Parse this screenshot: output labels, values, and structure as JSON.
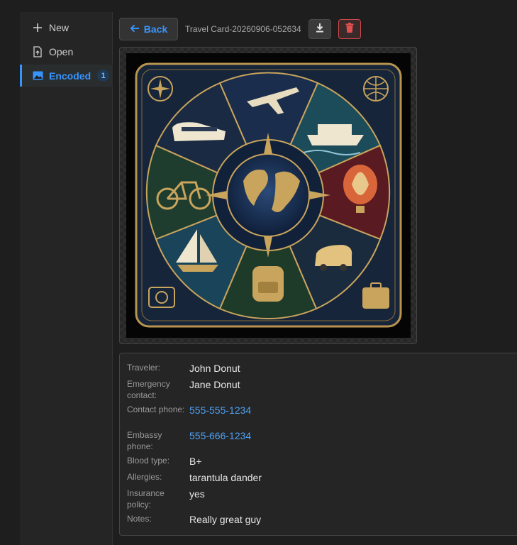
{
  "sidebar": {
    "items": [
      {
        "label": "New",
        "icon": "plus-icon"
      },
      {
        "label": "Open",
        "icon": "open-file-icon"
      },
      {
        "label": "Encoded",
        "icon": "image-icon",
        "badge": "1",
        "active": true
      }
    ]
  },
  "toolbar": {
    "back_label": "Back",
    "file_name": "Travel Card-20260906-052634",
    "download_icon": "download-icon",
    "delete_icon": "trash-icon"
  },
  "details": {
    "rows": [
      {
        "label": "Traveler:",
        "value": "John Donut"
      },
      {
        "label": "Emergency contact:",
        "value": "Jane Donut"
      },
      {
        "label": "Contact phone:",
        "value": "555-555-1234"
      },
      {
        "label": "Embassy phone:",
        "value": "555-666-1234"
      },
      {
        "label": "Blood type:",
        "value": "B+"
      },
      {
        "label": "Allergies:",
        "value": "tarantula dander"
      },
      {
        "label": "Insurance policy:",
        "value": "yes"
      },
      {
        "label": "Notes:",
        "value": "Really great guy"
      }
    ]
  },
  "colors": {
    "accent": "#3794ff",
    "link": "#4ea1f0",
    "danger": "#d04848",
    "card_gold": "#c9a45c",
    "card_navy": "#14243a"
  }
}
